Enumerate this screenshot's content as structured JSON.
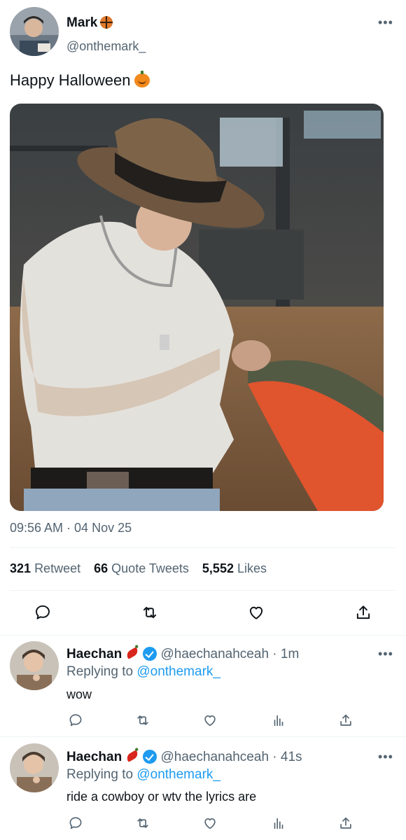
{
  "tweet": {
    "author_name": "Mark",
    "author_handle": "@onthemark_",
    "more_label": "•••",
    "text": "Happy Halloween",
    "timestamp": "09:56 AM · 04 Nov 25",
    "stats": {
      "retweets_count": "321",
      "retweets_label": "Retweet",
      "quotes_count": "66",
      "quotes_label": "Quote Tweets",
      "likes_count": "5,552",
      "likes_label": "Likes"
    }
  },
  "replies": [
    {
      "author_name": "Haechan",
      "author_handle": "@haechanahceah",
      "age": "· 1m",
      "replying_prefix": "Replying to",
      "replying_to": "@onthemark_",
      "text": "wow",
      "more_label": "•••"
    },
    {
      "author_name": "Haechan",
      "author_handle": "@haechanahceah",
      "age": "· 41s",
      "replying_prefix": "Replying to",
      "replying_to": "@onthemark_",
      "text": "ride a cowboy or wtv the lyrics are",
      "more_label": "•••"
    }
  ],
  "colors": {
    "text_primary": "#0f1419",
    "text_secondary": "#536471",
    "link": "#1d9bf0",
    "divider": "#eff3f4"
  },
  "icons": [
    "reply-icon",
    "retweet-icon",
    "like-icon",
    "share-icon",
    "analytics-icon",
    "verified-icon",
    "basketball-emoji",
    "pumpkin-emoji",
    "chili-emoji"
  ]
}
